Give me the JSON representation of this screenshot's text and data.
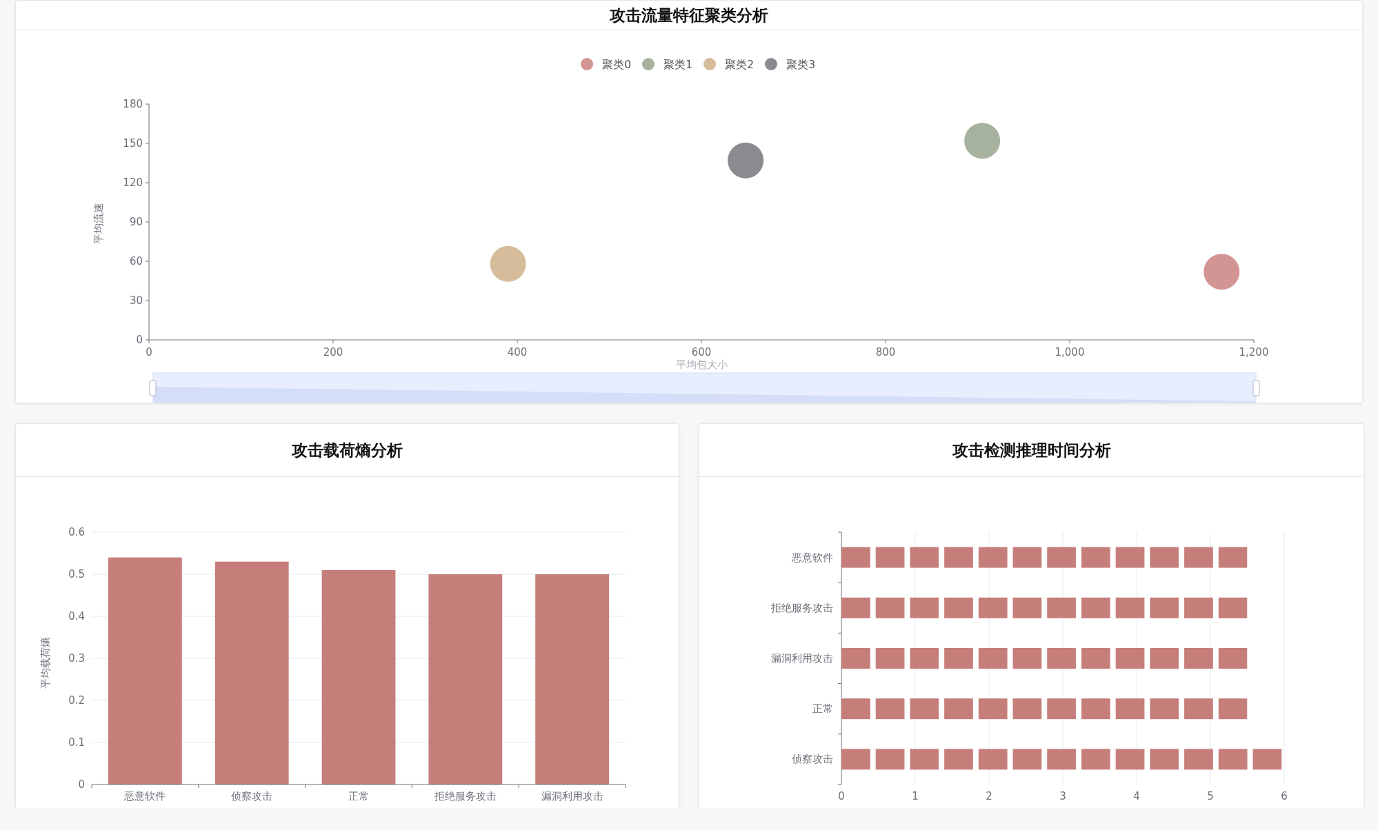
{
  "cluster_card": {
    "title": "攻击流量特征聚类分析",
    "chart_data": {
      "type": "scatter",
      "legend": "top",
      "xlabel": "平均包大小",
      "ylabel": "平均流速",
      "xlim": [
        0,
        1200
      ],
      "ylim": [
        0,
        180
      ],
      "xticks": [
        0,
        200,
        400,
        600,
        800,
        {
          "value": 1000,
          "label": "1,000"
        },
        {
          "value": 1200,
          "label": "1,200"
        }
      ],
      "yticks": [
        0,
        30,
        60,
        90,
        120,
        150,
        180
      ],
      "series": [
        {
          "name": "聚类0",
          "color": "#d39494",
          "x": [
            1165
          ],
          "values": [
            52
          ]
        },
        {
          "name": "聚类1",
          "color": "#a7b29e",
          "x": [
            905
          ],
          "values": [
            152
          ]
        },
        {
          "name": "聚类2",
          "color": "#d7bc9b",
          "x": [
            390
          ],
          "values": [
            58
          ]
        },
        {
          "name": "聚类3",
          "color": "#8a8b8f",
          "x": [
            648
          ],
          "values": [
            137
          ]
        }
      ]
    }
  },
  "entropy_card": {
    "title": "攻击载荷熵分析",
    "chart_data": {
      "type": "bar",
      "grid": true,
      "ylabel": "平均载荷熵",
      "categories": [
        "恶意软件",
        "侦察攻击",
        "正常",
        "拒绝服务攻击",
        "漏洞利用攻击"
      ],
      "values": [
        0.54,
        0.53,
        0.51,
        0.5,
        0.5
      ],
      "ylim": [
        0,
        0.6
      ],
      "yticks": [
        0,
        0.1,
        0.2,
        0.3,
        0.4,
        0.5,
        0.6
      ]
    }
  },
  "latency_card": {
    "title": "攻击检测推理时间分析",
    "chart_data": {
      "type": "bar",
      "orientation": "horizontal",
      "grid": true,
      "categories": [
        "恶意软件",
        "拒绝服务攻击",
        "漏洞利用攻击",
        "正常",
        "侦察攻击"
      ],
      "values": [
        5.5,
        5.5,
        5.5,
        5.5,
        6
      ],
      "xlim": [
        0,
        6
      ],
      "xticks": [
        0,
        1,
        2,
        3,
        4,
        5,
        6
      ]
    }
  }
}
